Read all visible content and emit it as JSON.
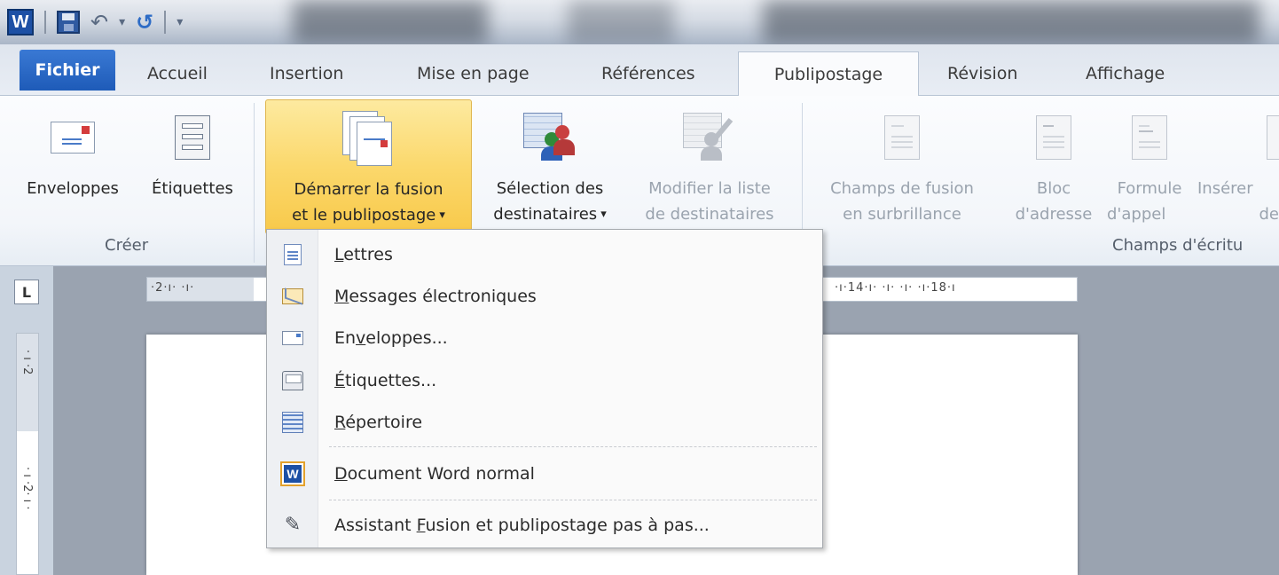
{
  "quick_access": {
    "app_icon_letter": "W",
    "undo_glyph": "↶",
    "dropdown_glyph": "▾",
    "redo_glyph": "↺",
    "customize_glyph": "▾"
  },
  "tabs": [
    {
      "label": "Fichier"
    },
    {
      "label": "Accueil"
    },
    {
      "label": "Insertion"
    },
    {
      "label": "Mise en page"
    },
    {
      "label": "Références"
    },
    {
      "label": "Publipostage",
      "active": true
    },
    {
      "label": "Révision"
    },
    {
      "label": "Affichage"
    }
  ],
  "ribbon": {
    "groups": {
      "creer": "Créer",
      "champs": "Champs d'écritu"
    },
    "buttons": {
      "enveloppes": "Enveloppes",
      "etiquettes": "Étiquettes",
      "demarrer_1": "Démarrer la fusion",
      "demarrer_2": "et le publipostage",
      "demarrer_arrow": "▾",
      "selection_1": "Sélection des",
      "selection_2": "destinataires",
      "selection_arrow": "▾",
      "modifier_1": "Modifier la liste",
      "modifier_2": "de destinataires",
      "champs_1": "Champs de fusion",
      "champs_2": "en surbrillance",
      "bloc_1": "Bloc",
      "bloc_2": "d'adresse",
      "formule_1": "Formule",
      "formule_2": "d'appel",
      "inserer_1": "Insérer",
      "inserer_2": "de f"
    }
  },
  "ruler": {
    "horizontal_left": "·2·ı· ·ı·",
    "horizontal_right": "·ı·14·ı· ·ı· ·ı· ·ı·18·ı",
    "vertical_top": "· ı ·2",
    "vertical_bottom": "· ı ·2· ı ·",
    "tab_selector": "L"
  },
  "menu": {
    "items": [
      {
        "before": "",
        "accel": "L",
        "after": "ettres"
      },
      {
        "before": "",
        "accel": "M",
        "after": "essages électroniques"
      },
      {
        "before": "En",
        "accel": "v",
        "after": "eloppes..."
      },
      {
        "before": "",
        "accel": "É",
        "after": "tiquettes..."
      },
      {
        "before": "",
        "accel": "R",
        "after": "épertoire"
      },
      {
        "before": "",
        "accel": "D",
        "after": "ocument Word normal"
      },
      {
        "before": "Assistant ",
        "accel": "F",
        "after": "usion et publipostage pas à pas..."
      }
    ]
  }
}
